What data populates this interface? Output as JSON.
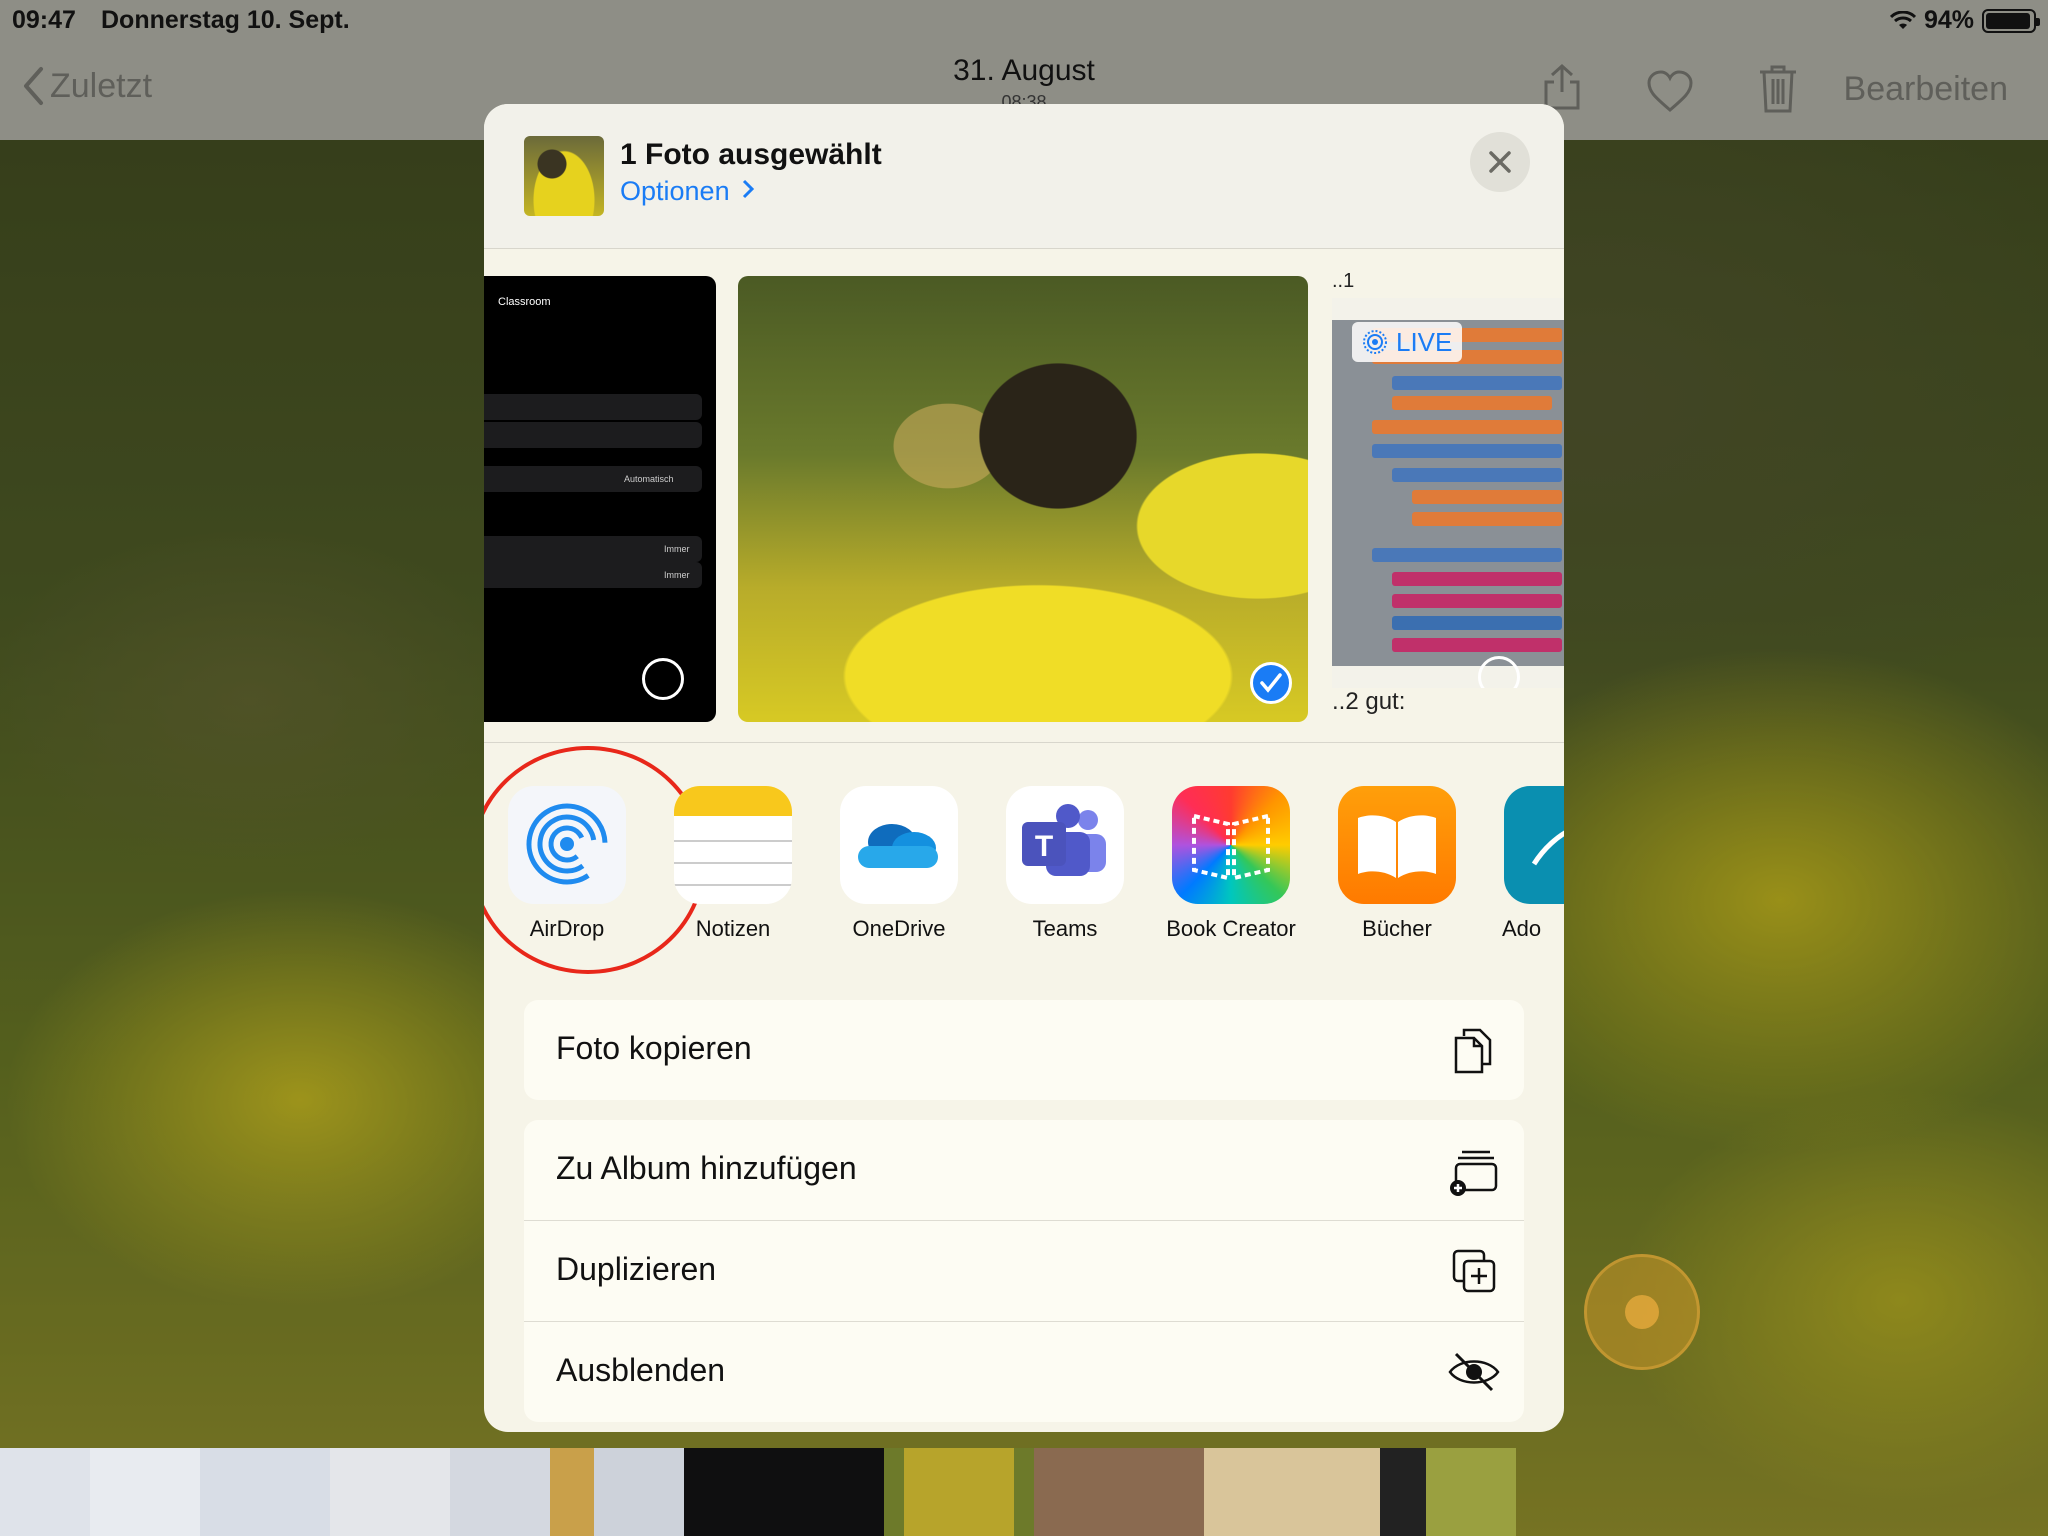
{
  "status": {
    "time": "09:47",
    "date": "Donnerstag 10. Sept.",
    "battery": "94%"
  },
  "nav": {
    "back": "Zuletzt",
    "title": "31. August",
    "subtitle": "08:38",
    "edit": "Bearbeiten"
  },
  "share": {
    "title": "1 Foto ausgewählt",
    "options": "Optionen",
    "preview": {
      "left_app_title": "Classroom",
      "left_texts": [
        "Automatisch",
        "Immer",
        "Immer"
      ],
      "right_top": "..1",
      "right_bottom": "..2 gut:",
      "live": "LIVE"
    },
    "apps": [
      {
        "label": "AirDrop",
        "icon": "airdrop-icon"
      },
      {
        "label": "Notizen",
        "icon": "notes-icon"
      },
      {
        "label": "OneDrive",
        "icon": "onedrive-icon"
      },
      {
        "label": "Teams",
        "icon": "teams-icon"
      },
      {
        "label": "Book Creator",
        "icon": "book-creator-icon"
      },
      {
        "label": "Bücher",
        "icon": "books-icon"
      },
      {
        "label": "Ado",
        "icon": "adobe-icon"
      }
    ],
    "actions": [
      {
        "label": "Foto kopieren",
        "icon": "copy-icon"
      },
      {
        "label": "Zu Album hinzufügen",
        "icon": "add-album-icon"
      },
      {
        "label": "Duplizieren",
        "icon": "duplicate-icon"
      },
      {
        "label": "Ausblenden",
        "icon": "hide-icon"
      }
    ]
  },
  "colors": {
    "accent": "#1a7cf5",
    "highlight_ring": "#e8271a"
  }
}
